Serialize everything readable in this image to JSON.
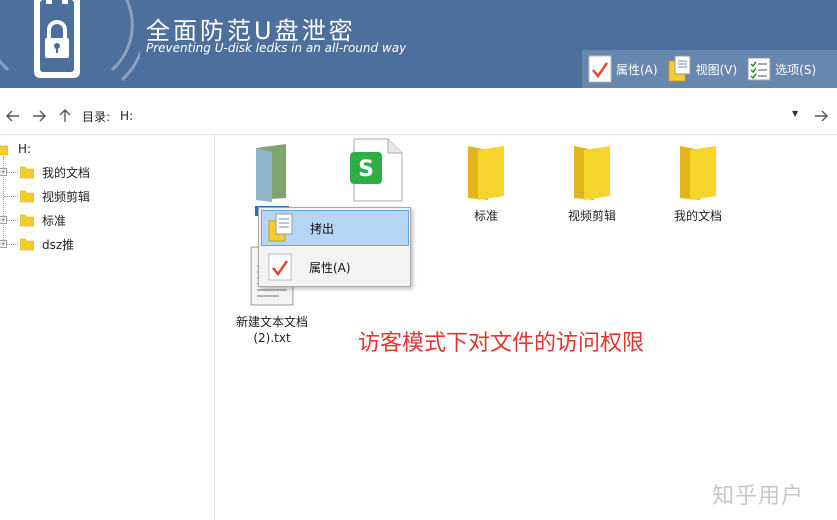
{
  "header": {
    "title": "全面防范U盘泄密",
    "subtitle": "Preventing U-disk ledks in an all-round way"
  },
  "toolbar": {
    "properties_label": "属性(A)",
    "view_label": "视图(V)",
    "options_label": "选项(S)"
  },
  "address": {
    "label": "目录:",
    "path": "H:"
  },
  "tree": {
    "root": "H:",
    "items": [
      {
        "label": "我的文档"
      },
      {
        "label": "视频剪辑"
      },
      {
        "label": "标准"
      },
      {
        "label": "dsz推"
      }
    ]
  },
  "files": [
    {
      "name": "",
      "type": "green-folder"
    },
    {
      "name": "",
      "type": "wps-sheet"
    },
    {
      "name": "标准",
      "type": "folder"
    },
    {
      "name": "视频剪辑",
      "type": "folder"
    },
    {
      "name": "我的文档",
      "type": "folder"
    },
    {
      "name": "新建文本文档\n(2).txt",
      "type": "text"
    }
  ],
  "context_menu": {
    "items": [
      {
        "label": "拷出",
        "icon": "copy-icon",
        "selected": true
      },
      {
        "label": "属性(A)",
        "icon": "checkmark-icon",
        "selected": false
      }
    ]
  },
  "annotation": "访客模式下对文件的访问权限",
  "watermark": "知乎用户",
  "colors": {
    "banner": "#4d6f9b",
    "toolbar": "#6887af",
    "menu_selected": "#b5d5f5",
    "annotation": "#e0362f",
    "folder_yellow": "#f5cd2d"
  }
}
